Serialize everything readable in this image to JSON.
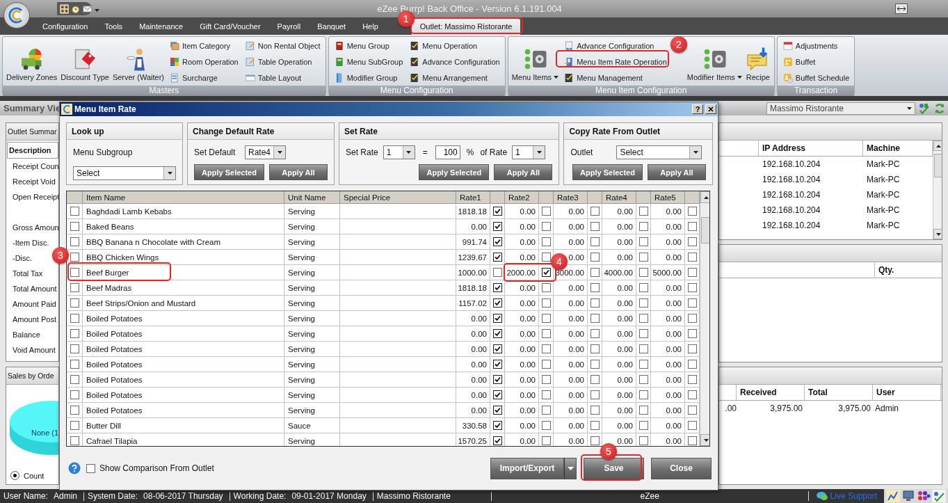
{
  "window": {
    "title": "eZee Burrp! Back Office - Version 6.1.191.004"
  },
  "menu": [
    {
      "label": "Configuration",
      "selected": false
    },
    {
      "label": "Tools",
      "selected": false
    },
    {
      "label": "Maintenance",
      "selected": false
    },
    {
      "label": "Gift Card/Voucher",
      "selected": false
    },
    {
      "label": "Payroll",
      "selected": false
    },
    {
      "label": "Banquet",
      "selected": false
    },
    {
      "label": "Help",
      "selected": false
    },
    {
      "label": "Outlet: Massimo Ristorante",
      "selected": true
    }
  ],
  "ribbon": [
    {
      "title": "Masters",
      "items": [
        {
          "label": "Delivery Zones",
          "kind": "large"
        },
        {
          "label": "Discount Type",
          "kind": "large"
        },
        {
          "label": "Server (Waiter)",
          "kind": "large"
        },
        {
          "label": "Item Category",
          "kind": "small"
        },
        {
          "label": "Room Operation",
          "kind": "small"
        },
        {
          "label": "Surcharge",
          "kind": "small"
        },
        {
          "label": "Non Rental Object",
          "kind": "small"
        },
        {
          "label": "Table Operation",
          "kind": "small"
        },
        {
          "label": "Table Layout",
          "kind": "small"
        }
      ]
    },
    {
      "title": "Menu Configuration",
      "items": [
        {
          "label": "Menu Group",
          "kind": "small"
        },
        {
          "label": "Menu SubGroup",
          "kind": "small"
        },
        {
          "label": "Modifier Group",
          "kind": "small"
        },
        {
          "label": "Menu Operation",
          "kind": "small"
        },
        {
          "label": "Advance Configuration",
          "kind": "small"
        },
        {
          "label": "Menu Arrangement",
          "kind": "small"
        }
      ]
    },
    {
      "title": "Menu Item Configuration",
      "items": [
        {
          "label": "Menu Items",
          "kind": "large-menu"
        },
        {
          "label": "Advance Configuration",
          "kind": "small"
        },
        {
          "label": "Menu Item Rate Operation",
          "kind": "small"
        },
        {
          "label": "Menu Management",
          "kind": "small"
        },
        {
          "label": "Modifier Items",
          "kind": "large-menu"
        },
        {
          "label": "Recipe",
          "kind": "large"
        }
      ]
    },
    {
      "title": "Transaction",
      "items": [
        {
          "label": "Adjustments",
          "kind": "small"
        },
        {
          "label": "Buffet",
          "kind": "small"
        },
        {
          "label": "Buffet Schedule",
          "kind": "small"
        }
      ]
    }
  ],
  "summary_bar": {
    "title": "Summary Vie",
    "outlet": "Massimo Ristorante"
  },
  "outlet_summary": {
    "title": "Outlet Summar",
    "header": "Description",
    "rows": [
      "Receipt Coun",
      "Receipt Void",
      "Open Receipt",
      "Gross Amoun",
      "-Item Disc.",
      "-Disc.",
      "Total Tax",
      "Total Amount",
      "Amount Paid",
      "Amount Post",
      "Balance",
      "Void Amount"
    ]
  },
  "sales_panel": {
    "title": "Sales by Orde",
    "slice_label": "None (1",
    "options": [
      {
        "label": "Count",
        "selected": true
      }
    ]
  },
  "sessions_table": {
    "columns": [
      "IP Address",
      "Machine"
    ],
    "rows": [
      [
        "192.168.10.204",
        "Mark-PC"
      ],
      [
        "192.168.10.204",
        "Mark-PC"
      ],
      [
        "192.168.10.204",
        "Mark-PC"
      ],
      [
        "192.168.10.204",
        "Mark-PC"
      ],
      [
        "192.168.10.204",
        "Mark-PC"
      ]
    ]
  },
  "items_table": {
    "columns": [
      "Qty."
    ]
  },
  "payments_table": {
    "columns": [
      "",
      "Received",
      "Total",
      "User"
    ],
    "rows": [
      [
        ".00",
        "3,975.00",
        "3,975.00",
        "Admin"
      ]
    ]
  },
  "dialog": {
    "title": "Menu Item Rate",
    "help": "?",
    "lookup": {
      "title": "Look up",
      "label": "Menu Subgroup",
      "value": "Select"
    },
    "default_rate": {
      "title": "Change Default Rate",
      "label": "Set Default",
      "value": "Rate4",
      "buttons": [
        "Apply Selected",
        "Apply All"
      ]
    },
    "set_rate": {
      "title": "Set Rate",
      "label": "Set Rate",
      "rate": "1",
      "equals": "=",
      "percent": "100",
      "percent_sign": "%",
      "of_label": "of Rate",
      "of_rate": "1",
      "buttons": [
        "Apply Selected",
        "Apply All"
      ]
    },
    "copy_rate": {
      "title": "Copy Rate From Outlet",
      "label": "Outlet",
      "value": "Select",
      "buttons": [
        "Apply Selected",
        "Apply All"
      ]
    },
    "grid": {
      "columns": [
        "Item Name",
        "Unit Name",
        "Special Price",
        "Rate1",
        "Rate2",
        "Rate3",
        "Rate4",
        "Rate5"
      ],
      "rows": [
        {
          "checked": false,
          "name": "Baghdadi Lamb Kebabs",
          "unit": "Serving",
          "rates": [
            {
              "value": "1818.18",
              "checked": true
            },
            {
              "value": "0.00",
              "checked": false
            },
            {
              "value": "0.00",
              "checked": false
            },
            {
              "value": "0.00",
              "checked": false
            },
            {
              "value": "0.00",
              "checked": false
            }
          ]
        },
        {
          "checked": false,
          "name": "Baked Beans",
          "unit": "Serving",
          "rates": [
            {
              "value": "0.00",
              "checked": true
            },
            {
              "value": "0.00",
              "checked": false
            },
            {
              "value": "0.00",
              "checked": false
            },
            {
              "value": "0.00",
              "checked": false
            },
            {
              "value": "0.00",
              "checked": false
            }
          ]
        },
        {
          "checked": false,
          "name": "BBQ Banana n Chocolate with Cream",
          "unit": "Serving",
          "rates": [
            {
              "value": "991.74",
              "checked": true
            },
            {
              "value": "0.00",
              "checked": false
            },
            {
              "value": "0.00",
              "checked": false
            },
            {
              "value": "0.00",
              "checked": false
            },
            {
              "value": "0.00",
              "checked": false
            }
          ]
        },
        {
          "checked": false,
          "name": "BBQ Chicken Wings",
          "unit": "Serving",
          "rates": [
            {
              "value": "1239.67",
              "checked": true
            },
            {
              "value": "0.00",
              "checked": false
            },
            {
              "value": "0.00",
              "checked": false
            },
            {
              "value": "0.00",
              "checked": false
            },
            {
              "value": "0.00",
              "checked": false
            }
          ]
        },
        {
          "checked": false,
          "name": "Beef Burger",
          "unit": "Serving",
          "rates": [
            {
              "value": "1000.00",
              "checked": false
            },
            {
              "value": "2000.00",
              "checked": true
            },
            {
              "value": "3000.00",
              "checked": false
            },
            {
              "value": "4000.00",
              "checked": false
            },
            {
              "value": "5000.00",
              "checked": false
            }
          ]
        },
        {
          "checked": false,
          "name": "Beef Madras",
          "unit": "Serving",
          "rates": [
            {
              "value": "1818.18",
              "checked": true
            },
            {
              "value": "0.00",
              "checked": false
            },
            {
              "value": "0.00",
              "checked": false
            },
            {
              "value": "0.00",
              "checked": false
            },
            {
              "value": "0.00",
              "checked": false
            }
          ]
        },
        {
          "checked": false,
          "name": "Beef Strips/Onion and Mustard",
          "unit": "Serving",
          "rates": [
            {
              "value": "1157.02",
              "checked": true
            },
            {
              "value": "0.00",
              "checked": false
            },
            {
              "value": "0.00",
              "checked": false
            },
            {
              "value": "0.00",
              "checked": false
            },
            {
              "value": "0.00",
              "checked": false
            }
          ]
        },
        {
          "checked": false,
          "name": "Boiled Potatoes",
          "unit": "Serving",
          "rates": [
            {
              "value": "0.00",
              "checked": true
            },
            {
              "value": "0.00",
              "checked": false
            },
            {
              "value": "0.00",
              "checked": false
            },
            {
              "value": "0.00",
              "checked": false
            },
            {
              "value": "0.00",
              "checked": false
            }
          ]
        },
        {
          "checked": false,
          "name": "Boiled Potatoes",
          "unit": "Serving",
          "rates": [
            {
              "value": "0.00",
              "checked": true
            },
            {
              "value": "0.00",
              "checked": false
            },
            {
              "value": "0.00",
              "checked": false
            },
            {
              "value": "0.00",
              "checked": false
            },
            {
              "value": "0.00",
              "checked": false
            }
          ]
        },
        {
          "checked": false,
          "name": "Boiled Potatoes",
          "unit": "Serving",
          "rates": [
            {
              "value": "0.00",
              "checked": true
            },
            {
              "value": "0.00",
              "checked": false
            },
            {
              "value": "0.00",
              "checked": false
            },
            {
              "value": "0.00",
              "checked": false
            },
            {
              "value": "0.00",
              "checked": false
            }
          ]
        },
        {
          "checked": false,
          "name": "Boiled Potatoes",
          "unit": "Serving",
          "rates": [
            {
              "value": "0.00",
              "checked": true
            },
            {
              "value": "0.00",
              "checked": false
            },
            {
              "value": "0.00",
              "checked": false
            },
            {
              "value": "0.00",
              "checked": false
            },
            {
              "value": "0.00",
              "checked": false
            }
          ]
        },
        {
          "checked": false,
          "name": "Boiled Potatoes",
          "unit": "Serving",
          "rates": [
            {
              "value": "0.00",
              "checked": true
            },
            {
              "value": "0.00",
              "checked": false
            },
            {
              "value": "0.00",
              "checked": false
            },
            {
              "value": "0.00",
              "checked": false
            },
            {
              "value": "0.00",
              "checked": false
            }
          ]
        },
        {
          "checked": false,
          "name": "Boiled Potatoes",
          "unit": "Serving",
          "rates": [
            {
              "value": "0.00",
              "checked": true
            },
            {
              "value": "0.00",
              "checked": false
            },
            {
              "value": "0.00",
              "checked": false
            },
            {
              "value": "0.00",
              "checked": false
            },
            {
              "value": "0.00",
              "checked": false
            }
          ]
        },
        {
          "checked": false,
          "name": "Boiled Potatoes",
          "unit": "Serving",
          "rates": [
            {
              "value": "0.00",
              "checked": true
            },
            {
              "value": "0.00",
              "checked": false
            },
            {
              "value": "0.00",
              "checked": false
            },
            {
              "value": "0.00",
              "checked": false
            },
            {
              "value": "0.00",
              "checked": false
            }
          ]
        },
        {
          "checked": false,
          "name": "Butter Dill",
          "unit": "Sauce",
          "rates": [
            {
              "value": "330.58",
              "checked": true
            },
            {
              "value": "0.00",
              "checked": false
            },
            {
              "value": "0.00",
              "checked": false
            },
            {
              "value": "0.00",
              "checked": false
            },
            {
              "value": "0.00",
              "checked": false
            }
          ]
        },
        {
          "checked": false,
          "name": "Cafrael Tilapia",
          "unit": "Serving",
          "rates": [
            {
              "value": "1570.25",
              "checked": true
            },
            {
              "value": "0.00",
              "checked": false
            },
            {
              "value": "0.00",
              "checked": false
            },
            {
              "value": "0.00",
              "checked": false
            },
            {
              "value": "0.00",
              "checked": false
            }
          ]
        }
      ]
    },
    "comparison": {
      "label": "Show Comparison From Outlet",
      "checked": false
    },
    "buttons": [
      {
        "label": "Import/Export",
        "kind": "split"
      },
      {
        "label": "Save",
        "kind": "plain"
      },
      {
        "label": "Close",
        "kind": "plain"
      }
    ]
  },
  "status_bar": {
    "fields": [
      {
        "label": "User Name:",
        "value": "Admin"
      },
      {
        "label": "System Date:",
        "value": "08-06-2017 Thursday"
      },
      {
        "label": "Working Date:",
        "value": "09-01-2017 Monday"
      }
    ],
    "outlet": "Massimo Ristorante",
    "center": "eZee",
    "link": "Live Support"
  },
  "annotations": [
    "1",
    "2",
    "3",
    "4",
    "5"
  ]
}
